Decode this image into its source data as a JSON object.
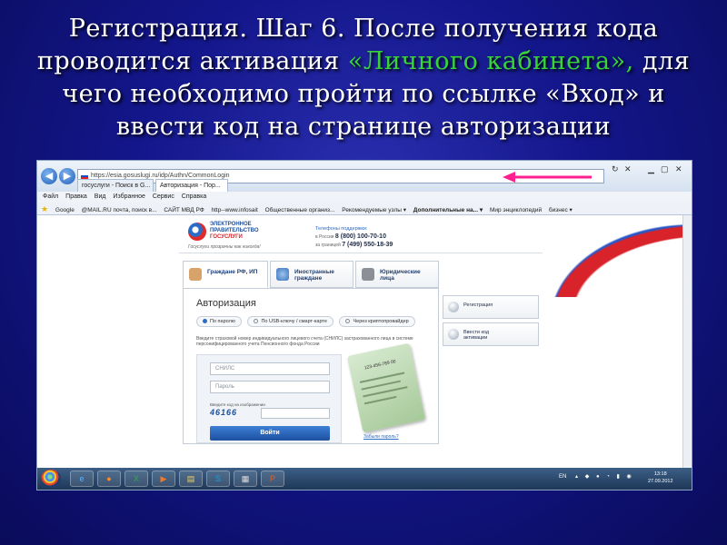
{
  "slide": {
    "title_part1": "Регистрация. Шаг 6. После получения кода проводится активация ",
    "title_highlight": "«Личного кабинета»,",
    "title_part2": " для чего необходимо пройти по ссылке «Вход» и ввести код на странице авторизации",
    "highlight_color": "#38d338"
  },
  "browser": {
    "url": "https://esia.gosuslugi.ru/idp/Authn/CommonLogin",
    "tabs": [
      "госуслуги - Поиск в G...",
      "Авторизация - Пор..."
    ],
    "menu": [
      "Файл",
      "Правка",
      "Вид",
      "Избранное",
      "Сервис",
      "Справка"
    ],
    "favorites": [
      "Google",
      "@MAIL.RU почта, поиск в...",
      "САЙТ МВД РФ",
      "http--www.infosait",
      "Общественные организ...",
      "Рекомендуемые узлы ▾",
      "Дополнительные на... ▾",
      "Мир энциклопедий",
      "бизнес ▾"
    ]
  },
  "site": {
    "logo_line1": "ЭЛЕКТРОННОЕ",
    "logo_line2": "ПРАВИТЕЛЬСТВО",
    "logo_line3": "ГОСУСЛУГИ",
    "slogan": "Госуслуги прозрачны как никогда!",
    "phone_title": "Телефоны поддержки:",
    "phone_ru_label": "в России",
    "phone_ru": "8 (800) 100-70-10",
    "phone_abroad_label": "за границей",
    "phone_abroad": "7 (499) 550-18-39",
    "categories": [
      {
        "label": "Граждане РФ, ИП"
      },
      {
        "label": "Иностранные граждане"
      },
      {
        "label": "Юридические лица"
      }
    ],
    "auth_title": "Авторизация",
    "auth_methods": [
      "По паролю",
      "По USB-ключу / смарт-карте",
      "Через криптопровайдер"
    ],
    "auth_hint": "Введите страховой номер индивидуального лицевого счета (СНИЛС) застрахованного лица в системе персонифицированного учета Пенсионного фонда России",
    "snils_placeholder": "СНИЛС",
    "password_placeholder": "Пароль",
    "captcha_label": "Введите код на изображении",
    "captcha_code": "46166",
    "login_button": "Войти",
    "forgot_password": "Забыли пароль?",
    "card_number": "123-456-789 00",
    "side_buttons": [
      {
        "label": "Регистрация"
      },
      {
        "label": "Ввести код активации"
      }
    ]
  },
  "taskbar": {
    "lang": "EN",
    "time": "13:18",
    "date": "27.09.2012"
  }
}
